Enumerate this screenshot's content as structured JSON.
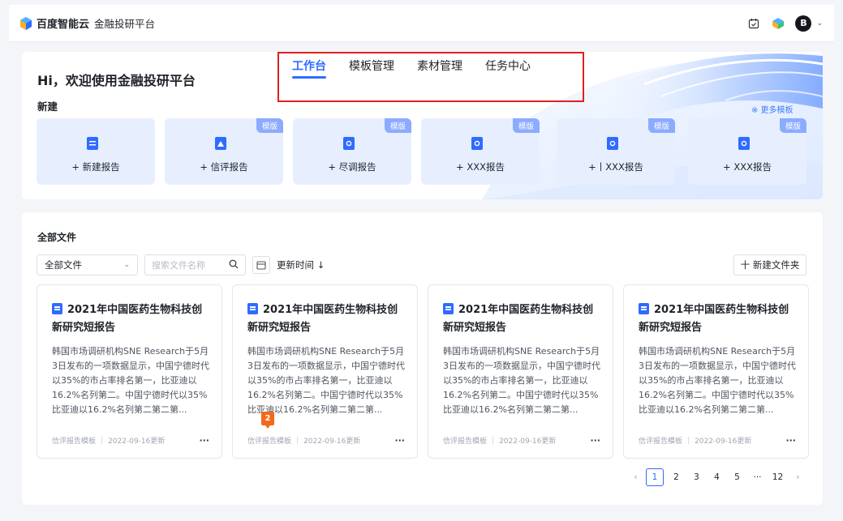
{
  "header": {
    "brand_name": "百度智能云",
    "brand_sub": "金融投研平台",
    "avatar_letter": "B"
  },
  "hero": {
    "greeting": "Hi，欢迎使用金融投研平台",
    "new_label": "新建",
    "more_templates": "※ 更多模板"
  },
  "tabs": [
    {
      "label": "工作台",
      "active": true
    },
    {
      "label": "模板管理",
      "active": false
    },
    {
      "label": "素材管理",
      "active": false
    },
    {
      "label": "任务中心",
      "active": false
    }
  ],
  "new_cards": [
    {
      "label": "+ 新建报告",
      "tag": ""
    },
    {
      "label": "+ 信评报告",
      "tag": "模版"
    },
    {
      "label": "+ 尽调报告",
      "tag": "模版"
    },
    {
      "label": "+  XXX报告",
      "tag": "模版"
    },
    {
      "label": "+丨XXX报告",
      "tag": "模版"
    },
    {
      "label": "+  XXX报告",
      "tag": "模版"
    }
  ],
  "files": {
    "title": "全部文件",
    "filter_value": "全部文件",
    "search_placeholder": "搜索文件名称",
    "sort_label": "更新时间 ↓",
    "new_folder": "十 新建文件夹",
    "cards": [
      {
        "title": "2021年中国医药生物科技创新研究短报告",
        "body": "韩国市场调研机构SNE Research于5月3日发布的一项数据显示，中国宁德时代以35%的市占率排名第一，比亚迪以16.2%名列第二。中国宁德时代以35%比亚迪以16.2%名列第二第二第...",
        "template": "信评报告模板",
        "date": "2022-09-16更新"
      },
      {
        "title": "2021年中国医药生物科技创新研究短报告",
        "body": "韩国市场调研机构SNE Research于5月3日发布的一项数据显示，中国宁德时代以35%的市占率排名第一，比亚迪以16.2%名列第二。中国宁德时代以35%比亚迪以16.2%名列第二第二第...",
        "template": "信评报告模板",
        "date": "2022-09-16更新"
      },
      {
        "title": "2021年中国医药生物科技创新研究短报告",
        "body": "韩国市场调研机构SNE Research于5月3日发布的一项数据显示，中国宁德时代以35%的市占率排名第一，比亚迪以16.2%名列第二。中国宁德时代以35%比亚迪以16.2%名列第二第二第...",
        "template": "信评报告模板",
        "date": "2022-09-16更新"
      },
      {
        "title": "2021年中国医药生物科技创新研究短报告",
        "body": "韩国市场调研机构SNE Research于5月3日发布的一项数据显示，中国宁德时代以35%的市占率排名第一，比亚迪以16.2%名列第二。中国宁德时代以35%比亚迪以16.2%名列第二第二第...",
        "template": "信评报告模板",
        "date": "2022-09-16更新"
      }
    ],
    "badge": "2"
  },
  "pagination": {
    "prev": "‹",
    "pages": [
      "1",
      "2",
      "3",
      "4",
      "5",
      "···",
      "12"
    ],
    "current": "1",
    "next": "›"
  },
  "colors": {
    "primary": "#2f6bff",
    "card_bg": "#e7efff",
    "tag_bg": "#8cabff",
    "highlight_box": "#e02020",
    "badge": "#f26a1b"
  }
}
